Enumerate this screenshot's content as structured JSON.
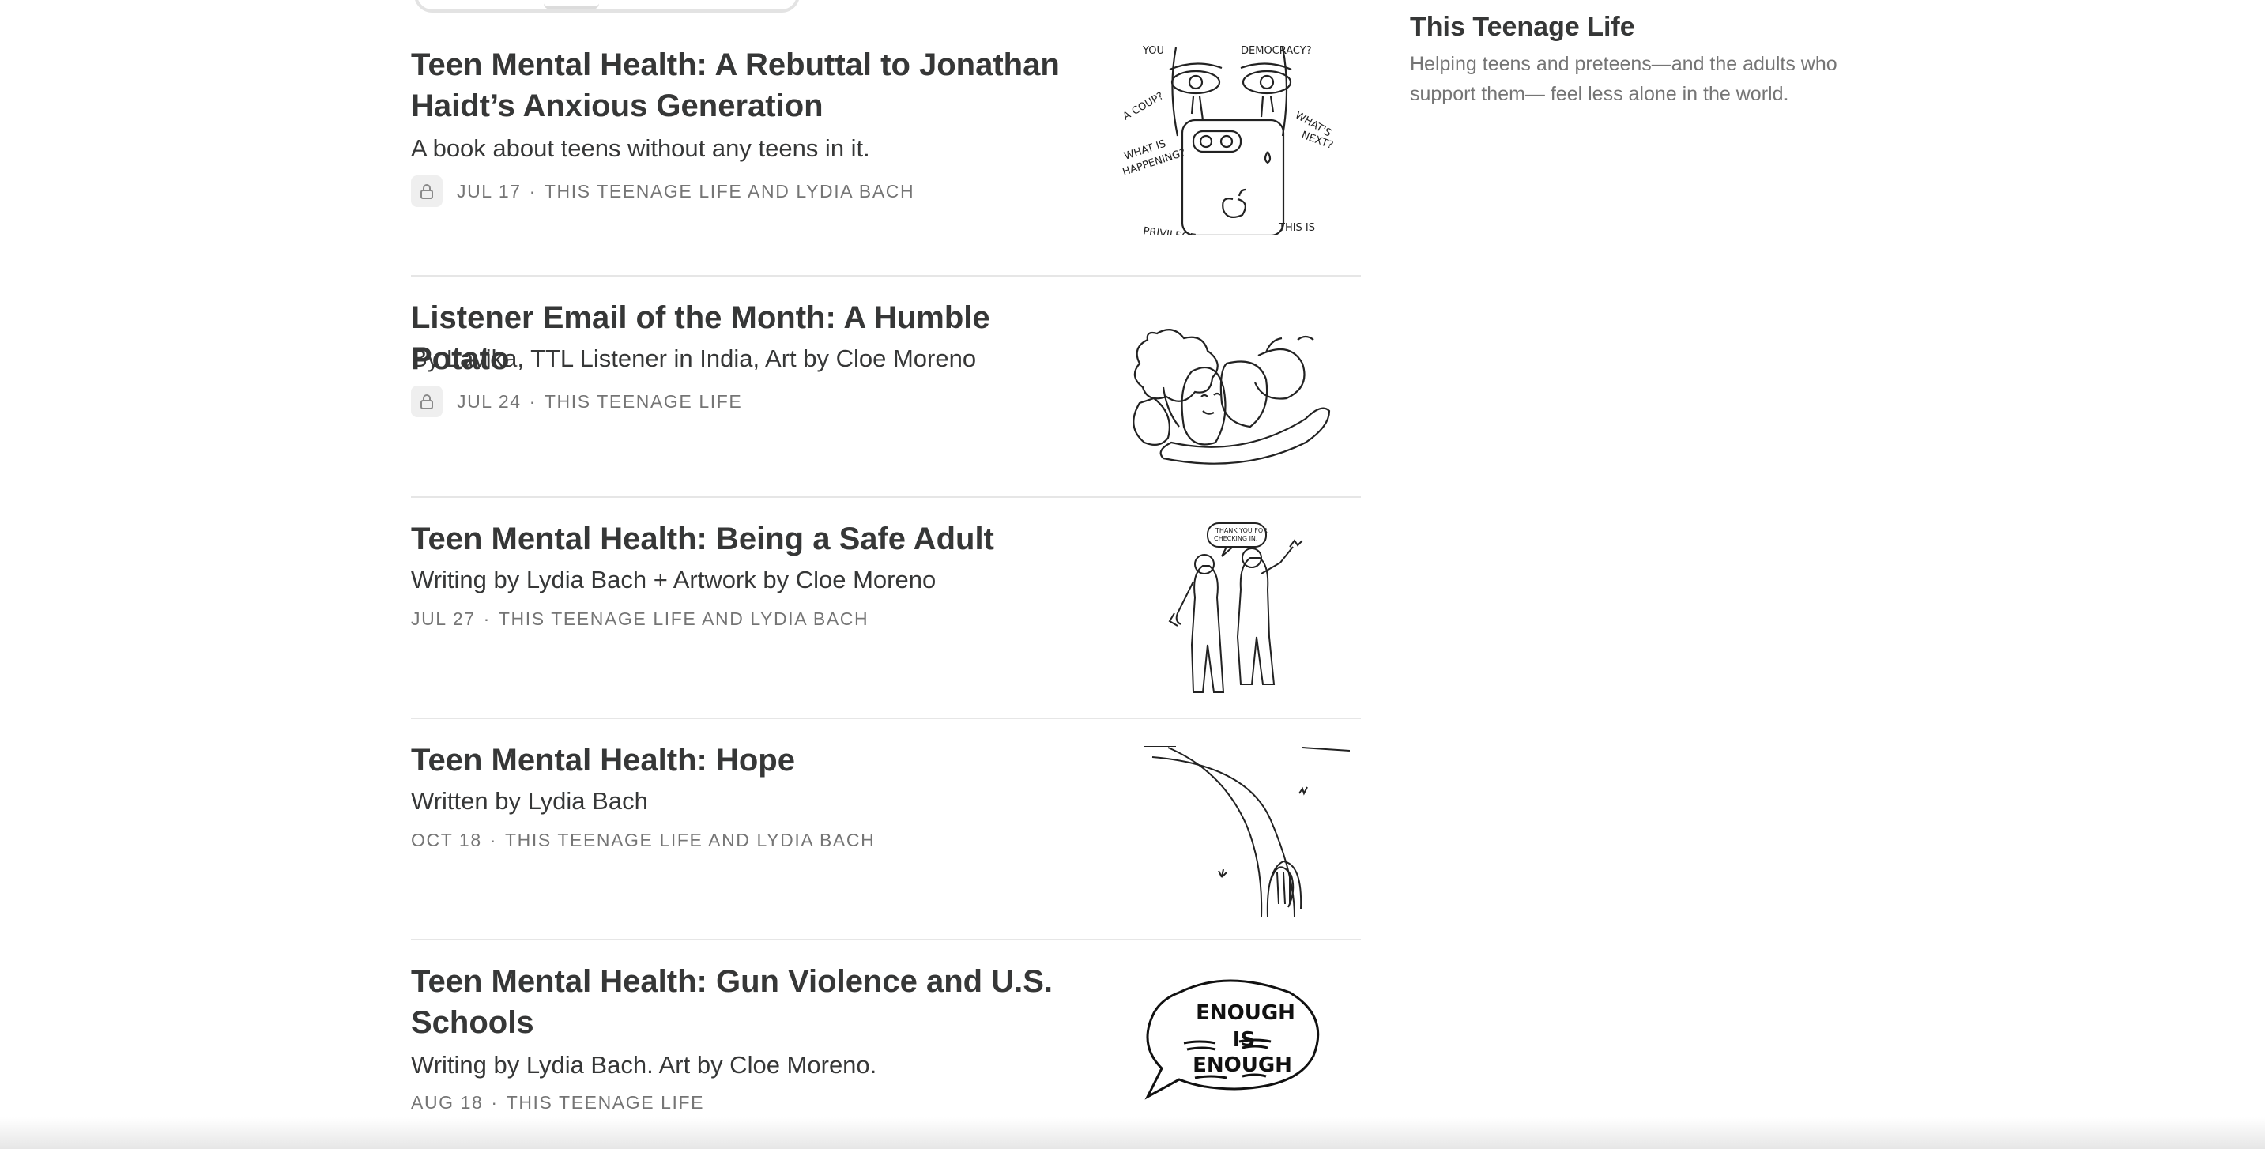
{
  "sidebar": {
    "publication_name": "This Teenage Life",
    "description": "Helping teens and preteens—and the adults who support them— feel less alone in the world."
  },
  "posts": [
    {
      "title": "Teen Mental Health: A Rebuttal to Jonathan Haidt’s Anxious Generation",
      "subtitle": "A book about teens without any teens in it.",
      "date": "JUL 17",
      "separator": "·",
      "authors": "THIS TEENAGE LIFE AND LYDIA BACH",
      "locked": true,
      "thumbnail": "face-with-phone-drawing"
    },
    {
      "title": "Listener Email of the Month: A Humble Potato",
      "subtitle": "By Lavika, TTL Listener in India, Art by Cloe Moreno",
      "date": "JUL 24",
      "separator": "·",
      "authors": "THIS TEENAGE LIFE",
      "locked": true,
      "thumbnail": "vegetables-drawing"
    },
    {
      "title": "Teen Mental Health: Being a Safe Adult",
      "subtitle": "Writing by Lydia Bach + Artwork by Cloe Moreno",
      "date": "JUL 27",
      "separator": "·",
      "authors": "THIS TEENAGE LIFE AND LYDIA BACH",
      "locked": false,
      "thumbnail": "two-people-walking-drawing"
    },
    {
      "title": "Teen Mental Health: Hope",
      "subtitle": "Written by Lydia Bach",
      "date": "OCT 18",
      "separator": "·",
      "authors": "THIS TEENAGE LIFE AND LYDIA BACH",
      "locked": false,
      "thumbnail": "person-on-path-drawing"
    },
    {
      "title": "Teen Mental Health: Gun Violence and U.S. Schools",
      "subtitle": "Writing by Lydia Bach. Art by Cloe Moreno.",
      "date": "AUG 18",
      "separator": "·",
      "authors": "THIS TEENAGE LIFE",
      "locked": false,
      "thumbnail": "speech-bubble-drawing",
      "thumbnail_text": [
        "ENOUGH",
        "IS",
        "ENOUGH"
      ]
    }
  ],
  "colors": {
    "text": "#363737",
    "muted": "#757575",
    "divider": "#e6e6e6",
    "lock_bg": "#efefef"
  }
}
